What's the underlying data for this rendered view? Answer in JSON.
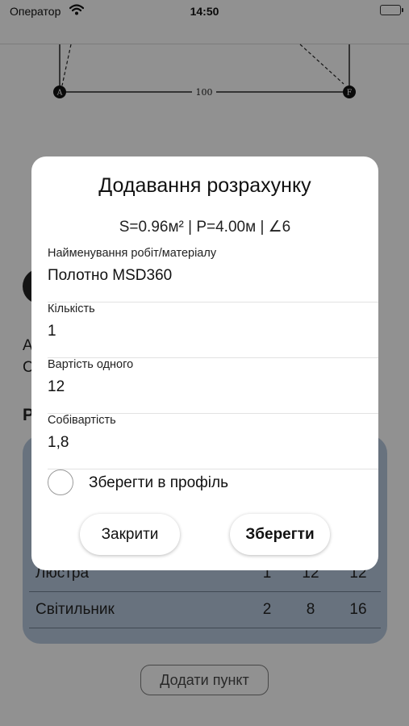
{
  "status_bar": {
    "carrier": "Оператор",
    "time": "14:50"
  },
  "background": {
    "diagram": {
      "point_a": "A",
      "point_f": "F",
      "side_length": "100"
    },
    "partial_text_1": "А",
    "partial_text_2": "С",
    "partial_heading": "Р",
    "table": {
      "rows": [
        {
          "name": "Люстра",
          "qty": "1",
          "price": "12",
          "total": "12"
        },
        {
          "name": "Світильник",
          "qty": "2",
          "price": "8",
          "total": "16"
        }
      ]
    },
    "add_item_label": "Додати пункт"
  },
  "modal": {
    "title": "Додавання розрахунку",
    "summary": "S=0.96м² | P=4.00м | ∠6",
    "fields": [
      {
        "label": "Найменування робіт/матеріалу",
        "value": "Полотно MSD360"
      },
      {
        "label": "Кількість",
        "value": "1"
      },
      {
        "label": "Вартість одного",
        "value": "12"
      },
      {
        "label": "Собівартість",
        "value": "1,8"
      }
    ],
    "save_to_profile_label": "Зберегти в профіль",
    "close_label": "Закрити",
    "save_label": "Зберегти"
  },
  "colors": {
    "table_background": "#aebfd3",
    "overlay": "rgba(0,0,0,0.40)",
    "modal_background": "#ffffff"
  }
}
